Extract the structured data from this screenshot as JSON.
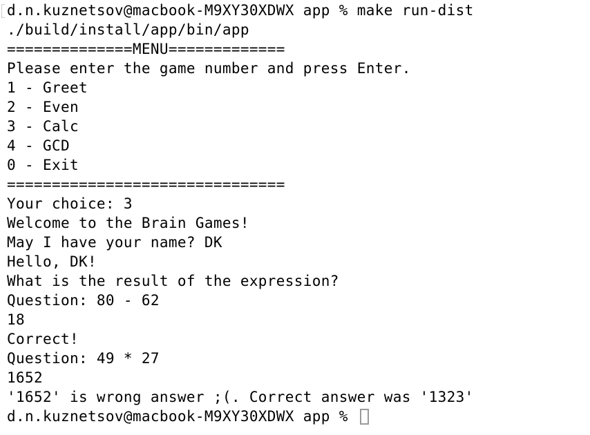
{
  "terminal": {
    "lines": [
      "d.n.kuznetsov@macbook-M9XY30XDWX app % make run-dist",
      "./build/install/app/bin/app",
      "==============MENU=============",
      "Please enter the game number and press Enter.",
      "1 - Greet",
      "2 - Even",
      "3 - Calc",
      "4 - GCD",
      "0 - Exit",
      "===============================",
      "Your choice: 3",
      "Welcome to the Brain Games!",
      "May I have your name? DK",
      "Hello, DK!",
      "What is the result of the expression?",
      "Question: 80 - 62",
      "18",
      "Correct!",
      "Question: 49 * 27",
      "1652",
      "'1652' is wrong answer ;(. Correct answer was '1323'"
    ],
    "prompt": "d.n.kuznetsov@macbook-M9XY30XDWX app % "
  }
}
